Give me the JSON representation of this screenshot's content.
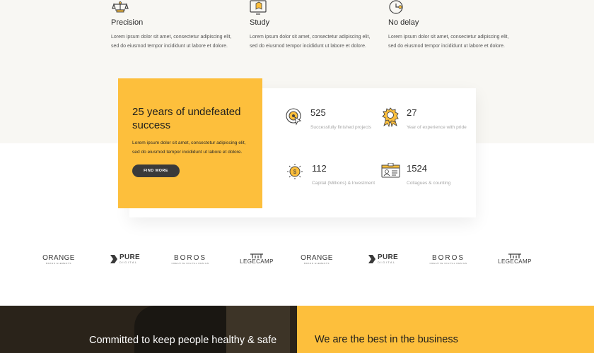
{
  "features": [
    {
      "icon": "scales-icon",
      "title": "Precision",
      "text": "Lorem ipsum dolor sit amet, consectetur adipiscing elit, sed do eiusmod tempor incididunt ut labore et dolore."
    },
    {
      "icon": "monitor-study-icon",
      "title": "Study",
      "text": "Lorem ipsum dolor sit amet, consectetur adipiscing elit, sed do eiusmod tempor incididunt ut labore et dolore."
    },
    {
      "icon": "clock-icon",
      "title": "No delay",
      "text": "Lorem ipsum dolor sit amet, consectetur adipiscing elit, sed do eiusmod tempor incididunt ut labore et dolore."
    }
  ],
  "promo": {
    "title": "25 years of undefeated success",
    "text": "Lorem ipsum dolor sit amet, consectetur adipiscing elit, sed do eiusmod tempor incididunt ut labore et dolore.",
    "button": "FIND MORE"
  },
  "stats": [
    {
      "icon": "target-cursor-icon",
      "number": "525",
      "label": "Successfully finished projects"
    },
    {
      "icon": "award-badge-icon",
      "number": "27",
      "label": "Year of experience with pride"
    },
    {
      "icon": "coin-icon",
      "number": "112",
      "label": "Capital (Millions) & Investment"
    },
    {
      "icon": "id-card-icon",
      "number": "1524",
      "label": "Collagues & counting"
    }
  ],
  "logos": [
    {
      "main": "ORANGE",
      "sub": "BRAND ELEMENTS"
    },
    {
      "main": "PURE",
      "sub": "DIGITAL"
    },
    {
      "main": "BOROS",
      "sub": "CREATIVE DIGITAL DESIGN"
    },
    {
      "main": "LEGECAMP",
      "sub": ""
    },
    {
      "main": "ORANGE",
      "sub": "BRAND ELEMENTS"
    },
    {
      "main": "PURE",
      "sub": "DIGITAL"
    },
    {
      "main": "BOROS",
      "sub": "CREATIVE DIGITAL DESIGN"
    },
    {
      "main": "LEGECAMP",
      "sub": ""
    }
  ],
  "bottom": {
    "left_title": "Committed to keep people healthy & safe",
    "right_title": "We are the best in the business"
  },
  "colors": {
    "accent": "#fdbf3c",
    "dark": "#3a3a3a"
  }
}
